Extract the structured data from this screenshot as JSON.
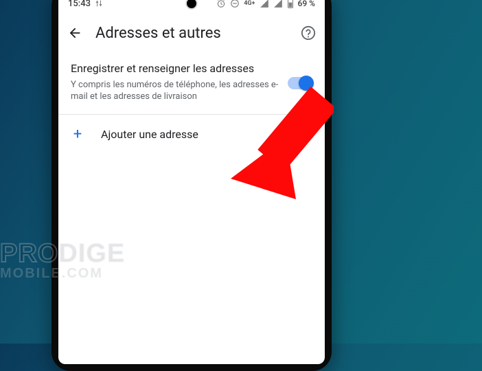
{
  "status": {
    "time": "15:43",
    "network_label": "4G+",
    "battery_text": "69 %"
  },
  "header": {
    "title": "Adresses et autres"
  },
  "setting": {
    "title": "Enregistrer et renseigner les adresses",
    "subtitle": "Y compris les numéros de téléphone, les adresses e-mail et les adresses de livraison",
    "toggle_on": true
  },
  "add_row": {
    "icon": "+",
    "label": "Ajouter une adresse"
  },
  "watermark": {
    "line1": "PRODIGE",
    "line2": "MOBILE.COM"
  }
}
